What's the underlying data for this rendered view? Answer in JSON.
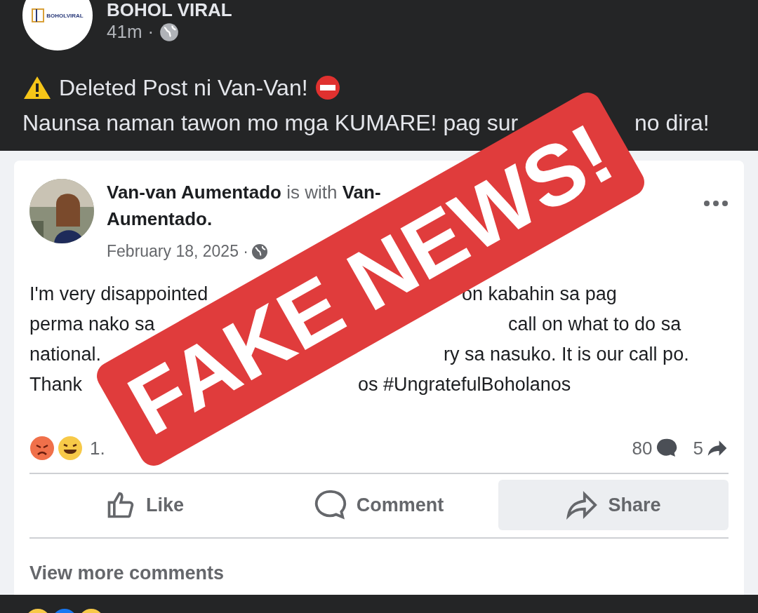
{
  "page": {
    "name": "BOHOL VIRAL",
    "logo_text": "BOHOLVIRAL",
    "time": "41m",
    "separator": "·"
  },
  "caption": [
    {
      "kind": "warning",
      "left": "Deleted Post ni Van-Van!"
    },
    {
      "kind": "plain",
      "left": "Naunsa naman tawon mo mga KUMARE! pag sur",
      "right": "no dira!"
    }
  ],
  "shared_post": {
    "author": "Van-van Aumentado",
    "connector": "is with",
    "tagged": "Van-",
    "tagged_rest": "Aumentado.",
    "date": "February 18, 2025 ·",
    "lines": [
      {
        "left": "I'm very disappointed",
        "right": "on kabahin sa pag"
      },
      {
        "left": "perma nako sa",
        "right": "call on what to do sa"
      },
      {
        "left": "national.",
        "right": "ry sa nasuko. It is our call po."
      },
      {
        "left": "Thank",
        "right": "os #UngratefulBoholanos"
      }
    ],
    "reaction_count": "1.",
    "comments": "80",
    "shares": "5",
    "actions": [
      {
        "label": "Like",
        "selected": false
      },
      {
        "label": "Comment",
        "selected": false
      },
      {
        "label": "Share",
        "selected": true
      }
    ],
    "view_more": "View more comments"
  },
  "stamp": {
    "text": "FAKE NEWS!"
  }
}
